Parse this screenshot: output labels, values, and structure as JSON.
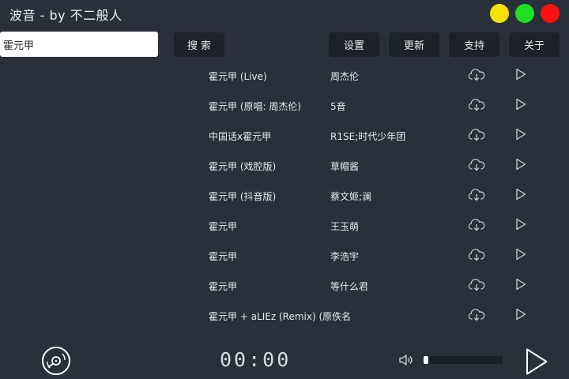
{
  "window": {
    "title": "波音 - by 不二般人",
    "buttons": [
      {
        "name": "minimize",
        "color": "#f5e10a"
      },
      {
        "name": "maximize",
        "color": "#1fe01f"
      },
      {
        "name": "close",
        "color": "#ff0f0f"
      }
    ]
  },
  "search": {
    "value": "霍元甲",
    "button_label": "搜 索"
  },
  "toolbar": {
    "settings_label": "设置",
    "update_label": "更新",
    "support_label": "支持",
    "about_label": "关于"
  },
  "songs": [
    {
      "name": "霍元甲 (Live)",
      "artist": "周杰伦"
    },
    {
      "name": "霍元甲 (原唱: 周杰伦)",
      "artist": "5音"
    },
    {
      "name": "中国话x霍元甲",
      "artist": "R1SE;时代少年团"
    },
    {
      "name": "霍元甲 (戏腔版)",
      "artist": "草帽酱"
    },
    {
      "name": "霍元甲 (抖音版)",
      "artist": "蔡文姬;澜"
    },
    {
      "name": "霍元甲",
      "artist": "王玉萌"
    },
    {
      "name": "霍元甲",
      "artist": "李浩宇"
    },
    {
      "name": "霍元甲",
      "artist": "等什么君"
    },
    {
      "name": "霍元甲 + aLIEz (Remix) (原佚名",
      "artist": ""
    }
  ],
  "player": {
    "time": "00:00",
    "volume": 0.06
  }
}
